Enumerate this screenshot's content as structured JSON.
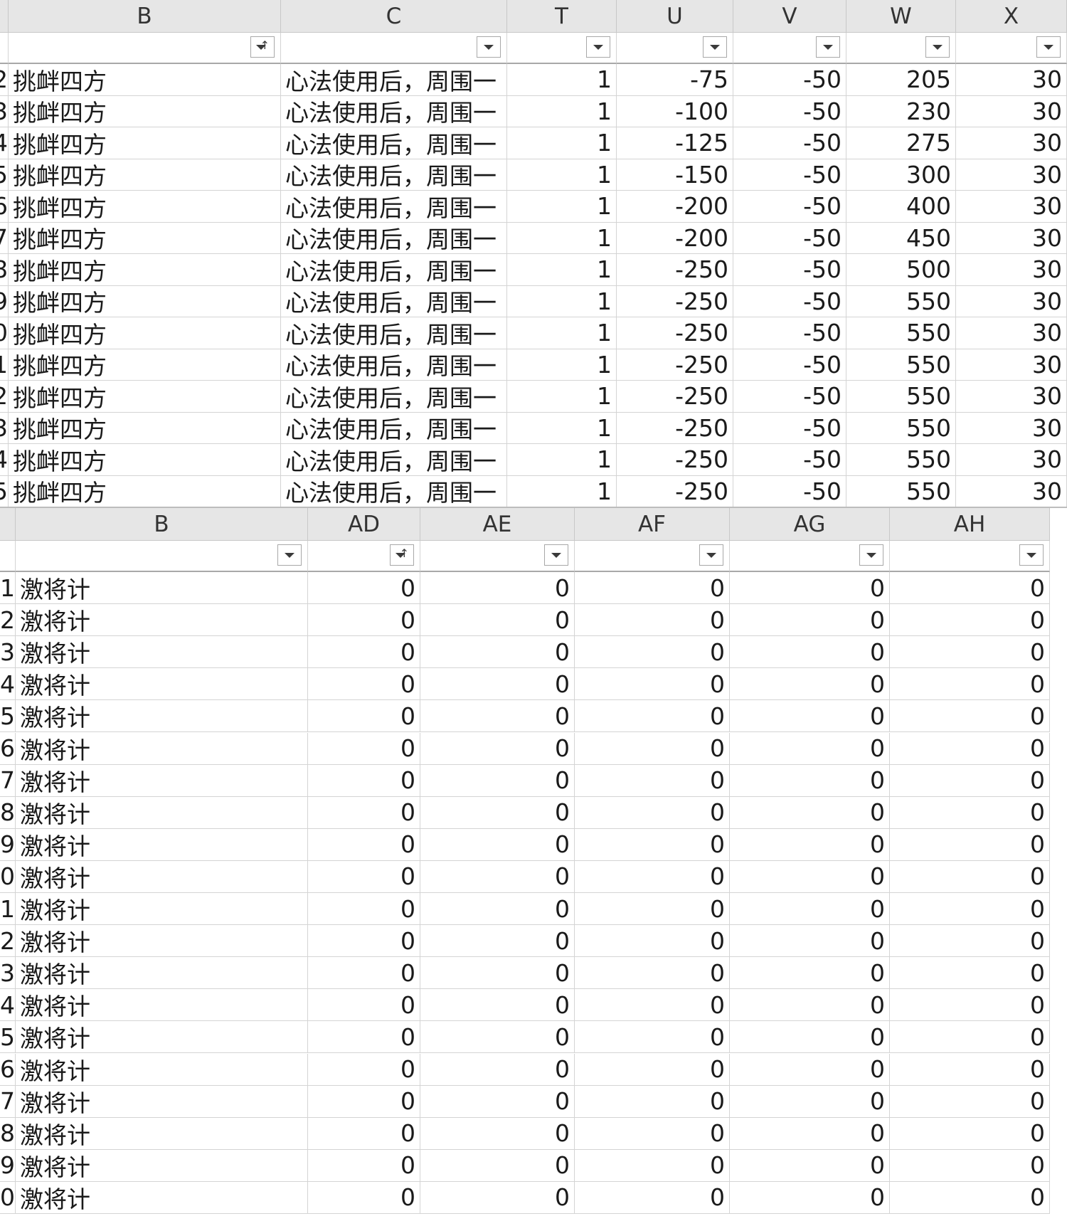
{
  "top_pane": {
    "columns": [
      "B",
      "C",
      "T",
      "U",
      "V",
      "W",
      "X"
    ],
    "row_numbers": [
      "2",
      "3",
      "4",
      "5",
      "6",
      "7",
      "8",
      "9",
      "0",
      "1",
      "2",
      "3",
      "4",
      "5"
    ],
    "rows": [
      {
        "B": "挑衅四方",
        "C": "心法使用后，周围一",
        "T": "1",
        "U": "-75",
        "V": "-50",
        "W": "205",
        "X": "30"
      },
      {
        "B": "挑衅四方",
        "C": "心法使用后，周围一",
        "T": "1",
        "U": "-100",
        "V": "-50",
        "W": "230",
        "X": "30"
      },
      {
        "B": "挑衅四方",
        "C": "心法使用后，周围一",
        "T": "1",
        "U": "-125",
        "V": "-50",
        "W": "275",
        "X": "30"
      },
      {
        "B": "挑衅四方",
        "C": "心法使用后，周围一",
        "T": "1",
        "U": "-150",
        "V": "-50",
        "W": "300",
        "X": "30"
      },
      {
        "B": "挑衅四方",
        "C": "心法使用后，周围一",
        "T": "1",
        "U": "-200",
        "V": "-50",
        "W": "400",
        "X": "30"
      },
      {
        "B": "挑衅四方",
        "C": "心法使用后，周围一",
        "T": "1",
        "U": "-200",
        "V": "-50",
        "W": "450",
        "X": "30"
      },
      {
        "B": "挑衅四方",
        "C": "心法使用后，周围一",
        "T": "1",
        "U": "-250",
        "V": "-50",
        "W": "500",
        "X": "30"
      },
      {
        "B": "挑衅四方",
        "C": "心法使用后，周围一",
        "T": "1",
        "U": "-250",
        "V": "-50",
        "W": "550",
        "X": "30"
      },
      {
        "B": "挑衅四方",
        "C": "心法使用后，周围一",
        "T": "1",
        "U": "-250",
        "V": "-50",
        "W": "550",
        "X": "30"
      },
      {
        "B": "挑衅四方",
        "C": "心法使用后，周围一",
        "T": "1",
        "U": "-250",
        "V": "-50",
        "W": "550",
        "X": "30"
      },
      {
        "B": "挑衅四方",
        "C": "心法使用后，周围一",
        "T": "1",
        "U": "-250",
        "V": "-50",
        "W": "550",
        "X": "30"
      },
      {
        "B": "挑衅四方",
        "C": "心法使用后，周围一",
        "T": "1",
        "U": "-250",
        "V": "-50",
        "W": "550",
        "X": "30"
      },
      {
        "B": "挑衅四方",
        "C": "心法使用后，周围一",
        "T": "1",
        "U": "-250",
        "V": "-50",
        "W": "550",
        "X": "30"
      },
      {
        "B": "挑衅四方",
        "C": "心法使用后，周围一",
        "T": "1",
        "U": "-250",
        "V": "-50",
        "W": "550",
        "X": "30"
      }
    ]
  },
  "bottom_pane": {
    "columns": [
      "B",
      "AD",
      "AE",
      "AF",
      "AG",
      "AH"
    ],
    "row_numbers": [
      "1",
      "2",
      "3",
      "4",
      "5",
      "6",
      "7",
      "8",
      "9",
      "0",
      "1",
      "2",
      "3",
      "4",
      "5",
      "6",
      "7",
      "8",
      "9",
      "0"
    ],
    "rows": [
      {
        "B": "激将计",
        "AD": "0",
        "AE": "0",
        "AF": "0",
        "AG": "0",
        "AH": "0"
      },
      {
        "B": "激将计",
        "AD": "0",
        "AE": "0",
        "AF": "0",
        "AG": "0",
        "AH": "0"
      },
      {
        "B": "激将计",
        "AD": "0",
        "AE": "0",
        "AF": "0",
        "AG": "0",
        "AH": "0"
      },
      {
        "B": "激将计",
        "AD": "0",
        "AE": "0",
        "AF": "0",
        "AG": "0",
        "AH": "0"
      },
      {
        "B": "激将计",
        "AD": "0",
        "AE": "0",
        "AF": "0",
        "AG": "0",
        "AH": "0"
      },
      {
        "B": "激将计",
        "AD": "0",
        "AE": "0",
        "AF": "0",
        "AG": "0",
        "AH": "0"
      },
      {
        "B": "激将计",
        "AD": "0",
        "AE": "0",
        "AF": "0",
        "AG": "0",
        "AH": "0"
      },
      {
        "B": "激将计",
        "AD": "0",
        "AE": "0",
        "AF": "0",
        "AG": "0",
        "AH": "0"
      },
      {
        "B": "激将计",
        "AD": "0",
        "AE": "0",
        "AF": "0",
        "AG": "0",
        "AH": "0"
      },
      {
        "B": "激将计",
        "AD": "0",
        "AE": "0",
        "AF": "0",
        "AG": "0",
        "AH": "0"
      },
      {
        "B": "激将计",
        "AD": "0",
        "AE": "0",
        "AF": "0",
        "AG": "0",
        "AH": "0"
      },
      {
        "B": "激将计",
        "AD": "0",
        "AE": "0",
        "AF": "0",
        "AG": "0",
        "AH": "0"
      },
      {
        "B": "激将计",
        "AD": "0",
        "AE": "0",
        "AF": "0",
        "AG": "0",
        "AH": "0"
      },
      {
        "B": "激将计",
        "AD": "0",
        "AE": "0",
        "AF": "0",
        "AG": "0",
        "AH": "0"
      },
      {
        "B": "激将计",
        "AD": "0",
        "AE": "0",
        "AF": "0",
        "AG": "0",
        "AH": "0"
      },
      {
        "B": "激将计",
        "AD": "0",
        "AE": "0",
        "AF": "0",
        "AG": "0",
        "AH": "0"
      },
      {
        "B": "激将计",
        "AD": "0",
        "AE": "0",
        "AF": "0",
        "AG": "0",
        "AH": "0"
      },
      {
        "B": "激将计",
        "AD": "0",
        "AE": "0",
        "AF": "0",
        "AG": "0",
        "AH": "0"
      },
      {
        "B": "激将计",
        "AD": "0",
        "AE": "0",
        "AF": "0",
        "AG": "0",
        "AH": "0"
      },
      {
        "B": "激将计",
        "AD": "0",
        "AE": "0",
        "AF": "0",
        "AG": "0",
        "AH": "0"
      }
    ]
  },
  "sort_indicator_symbol": "↑",
  "colors": {
    "header_bg": "#e6e6e6",
    "grid_line": "#d4d4d4"
  }
}
